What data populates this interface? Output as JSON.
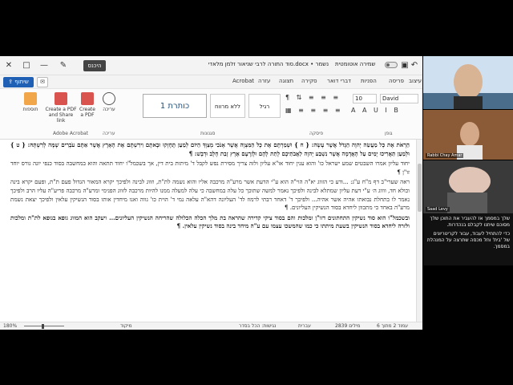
{
  "window": {
    "title": "סוד התורה לרבי שניאור זלמן מלאדי.docx • נשמר",
    "save_toggle_label": "שמירה אוטומטית",
    "signin_label": "היכנס",
    "toolbar_icons": [
      "undo-icon",
      "redo-icon",
      "save-icon",
      "search-icon"
    ]
  },
  "tabs": {
    "share": "שיתוף",
    "items": [
      "קובץ",
      "בית",
      "הוספה",
      "ציור",
      "עיצוב",
      "פריסה",
      "הפניות",
      "דברי דואר",
      "סקירה",
      "תצוגה",
      "עזרה",
      "Acrobat"
    ]
  },
  "ribbon": {
    "groups": [
      "Adobe Acrobat",
      "עריכה",
      "סגנונות",
      "פיסקה",
      "גופן"
    ],
    "acrobat_buttons": [
      "Create a PDF",
      "Create a PDF and Share link",
      "תוספות"
    ],
    "edit_label": "עריכה",
    "styles": {
      "normal": "רגיל",
      "no_spacing": "ללא מרווח",
      "heading1": "כותרת 1"
    },
    "font_size": "10",
    "font_name": "David"
  },
  "document": {
    "paragraphs": [
      "הַרְאֹת אֶת כָּל מַעֲשֵׂה יְהוָה הַגָּדֹל אֲשֶׁר עָשָׂה: { ח } וּשְׁמַרְתֶּם אֶת כָּל הַמִּצְוָה אֲשֶׁר אָנֹכִי מְצַוְּךָ הַיּוֹם לְמַעַן תֶּחֶזְקוּ וּבָאתֶם וִירִשְׁתֶּם אֶת הָאָרֶץ אֲשֶׁר אַתֶּם עֹבְרִים שָׁמָּה לְרִשְׁתָּהּ: { ט } וּלְמַעַן תַּאֲרִיכוּ יָמִים עַל הָאֲדָמָה אֲשֶׁר נִשְׁבַּע יְהוָה לַאֲבֹתֵיכֶם לָתֵת לָהֶם וּלְזַרְעָם אֶרֶץ זָבַת חָלָב וּדְבָשׁ: ¶",
      "יחוד עליון אמרו השבטים שמע ישראל כו' והוא ענין יחוד או\"א עליון ולזה צריך מסירת נפש לקבל ד' מיתות בית דין, אך בשכמל\"ו יחוד תתאה והוא במחשבה בסוד כנפי יונה גורס יוחד זו\"ן ¶",
      "ראה שערי\"ב דף מ\"ח ע\"ג: ...ודע כי הזווג יא\"ה הוי\"ה הוא ע\"י הדעת אשר מרע\"ה מרכבה אליו והוא נשמה לת\"ת, וזווג לבינה ולפיכך יקרא המאור הגדול פעם ת\"ת, ופעם יקרא בינה וכולא חד, ווווג ה׳ ע\"י דעת עליון שמתלא לבינה ולפיכך נאמר למשה שתוכך כל עלה במחשבה כי עלה למעלה ממנו להיות מרכבה לזווג הפנימי ומרע\"ה מרכבה פריע\"ה עליו הרב ולפיכך נאמר לו בתחלת נבואתו אהיה אשר אהיה... ולפיכך ד' דאחד רבתי לרמוז לד' העליונה דהא\"ה עלאה נמי ד' הוית כו' גווה ואנו מיחדין אותו בסוד הנשיקין עלאין ולפיכך יצאת נשמת מרע\"ה באחד כי מתכוון ליחדא בסוד הנשיקין העליונים. ¶",
      "ובשכמל\"ו הוא סוד נשיקין התחתונים דזו\"ן ומלכות והם בסוד ציקי קדירה שהראה בת מלך הכלה הכלולה שהריחה הנשיקין העליונים... ויעקב הוא המווג גופא בגופא לת\"ת ומלכות ולזרה ליחדא בסוד הנשיקין בשעת מיתתו כי כמו שהמשכו עצמו עם ע\"ה מיחד בינה בסוד נשיקין עלאין. ¶"
    ]
  },
  "status": {
    "page": "עמוד 2 מתוך 6",
    "words": "2839 מילים",
    "language": "עברית",
    "accessibility": "נגישות: הכל בסדר",
    "focus": "מיקוד",
    "zoom": "180%"
  },
  "participants": [
    {
      "name": ""
    },
    {
      "name": "Rabbi Chay Amar"
    },
    {
      "name": "Saad Levy"
    }
  ],
  "chat": {
    "lines": [
      "שלך במסמך אז להעביר את התוכן שלך מסוכם שיתנו לקבלם בנהדרות.",
      "כדי להתחיל לעבוד, עבור לקריטריונים של 'בית' וחל מכסה שתרצה על המנהלת במסמך."
    ]
  }
}
